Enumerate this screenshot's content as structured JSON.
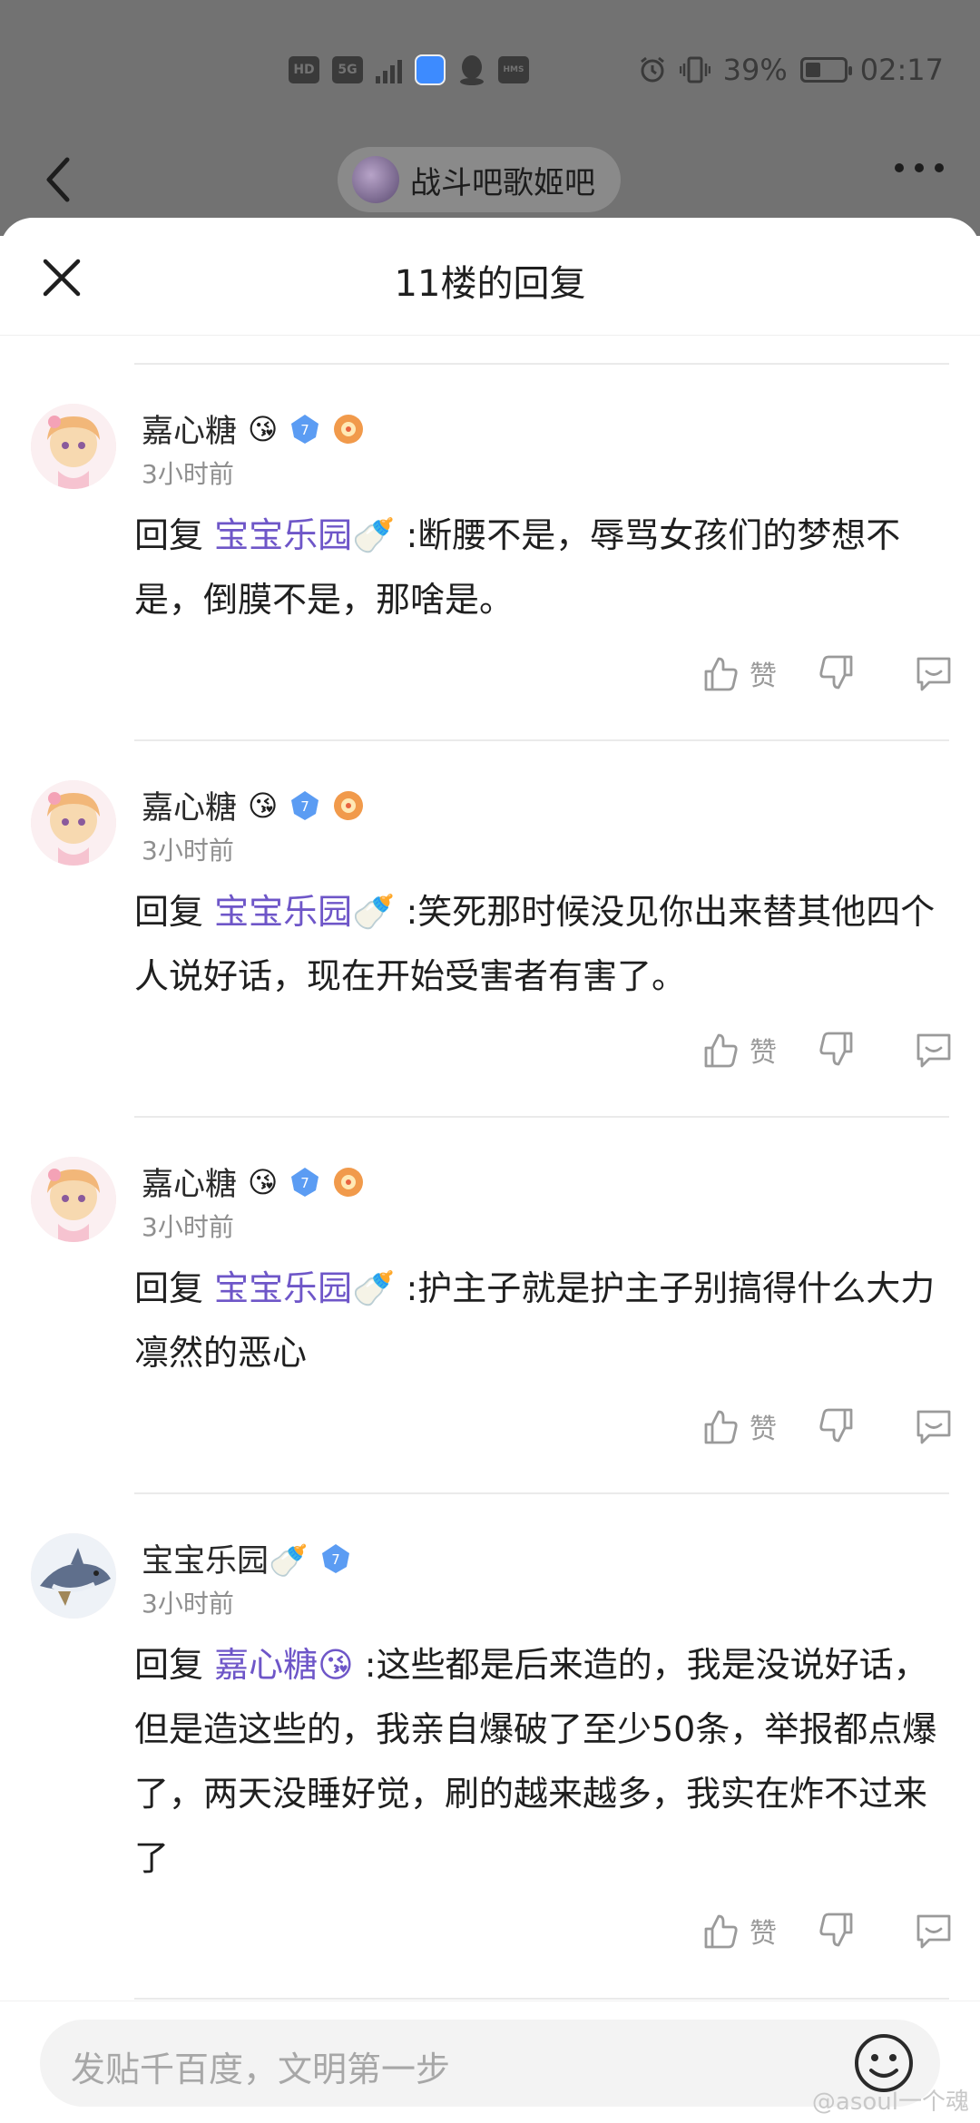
{
  "status_bar": {
    "hd": "HD",
    "network": "5G",
    "battery_percent": "39%",
    "battery_level": 0.39,
    "time": "02:17"
  },
  "header": {
    "forum_name": "战斗吧歌姬吧"
  },
  "sheet": {
    "title": "11楼的回复"
  },
  "comments": [
    {
      "username": "嘉心糖",
      "name_emoji": "😘",
      "time": "3小时前",
      "reply_prefix": "回复 ",
      "reply_to": "宝宝乐园🍼",
      "text": " :断腰不是，辱骂女孩们的梦想不是，倒膜不是，那啥是。",
      "like_label": "赞"
    },
    {
      "username": "嘉心糖",
      "name_emoji": "😘",
      "time": "3小时前",
      "reply_prefix": "回复 ",
      "reply_to": "宝宝乐园🍼",
      "text": " :笑死那时候没见你出来替其他四个人说好话，现在开始受害者有害了。",
      "like_label": "赞"
    },
    {
      "username": "嘉心糖",
      "name_emoji": "😘",
      "time": "3小时前",
      "reply_prefix": "回复 ",
      "reply_to": "宝宝乐园🍼",
      "text": " :护主子就是护主子别搞得什么大力凛然的恶心",
      "like_label": "赞"
    },
    {
      "username": "宝宝乐园🍼",
      "name_emoji": "",
      "time": "3小时前",
      "reply_prefix": "回复 ",
      "reply_to": "嘉心糖😘",
      "text": " :这些都是后来造的，我是没说好话，但是造这些的，我亲自爆破了至少50条，举报都点爆了，两天没睡好觉，刷的越来越多，我实在炸不过来了",
      "like_label": "赞"
    }
  ],
  "bottom": {
    "input_placeholder": "发贴千百度，文明第一步",
    "watermark": "@asoul一个魂"
  },
  "colors": {
    "accent_link": "#6e56c8",
    "badge_blue": "#5b9cf3",
    "badge_orange": "#f19a4b"
  }
}
